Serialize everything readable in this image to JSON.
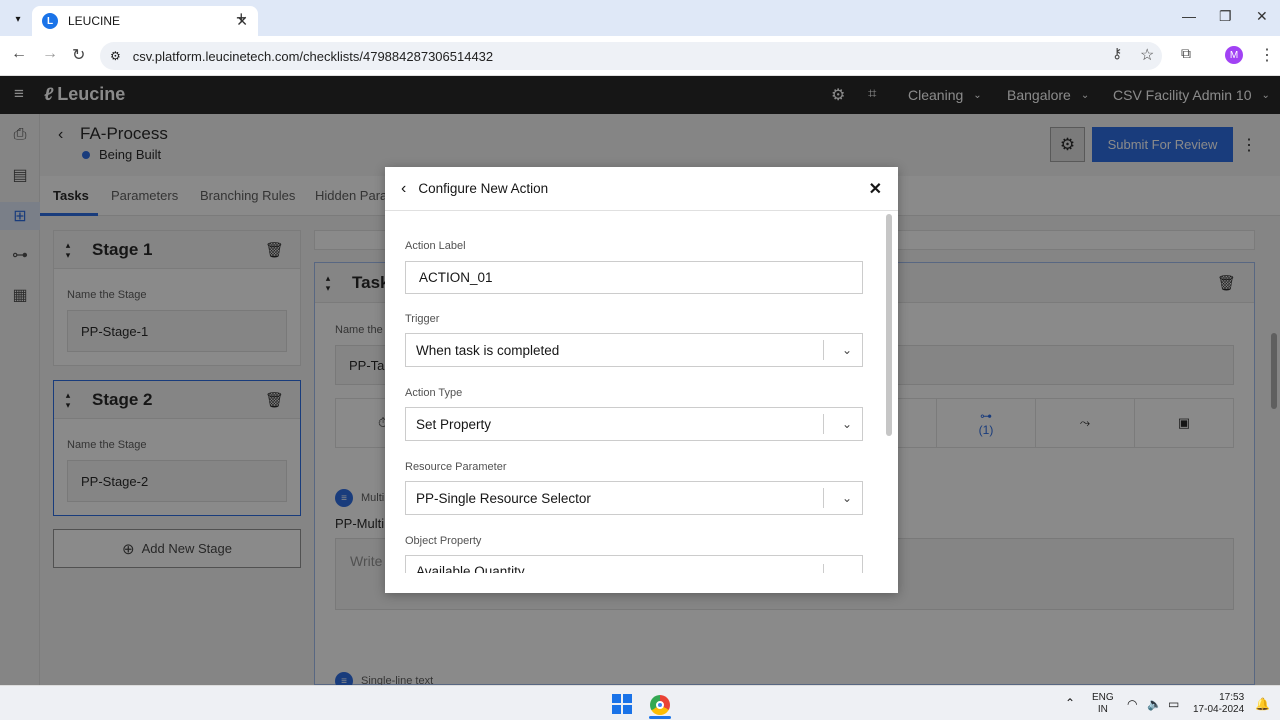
{
  "browser": {
    "tab_title": "LEUCINE",
    "tab_close": "✕",
    "new_tab": "+",
    "url": "csv.platform.leucinetech.com/checklists/479884287306514432",
    "profile_initial": "M"
  },
  "app": {
    "brand": "Leucine",
    "header": {
      "facility_type": "Cleaning",
      "location": "Bangalore",
      "user": "CSV Facility Admin 10"
    }
  },
  "process": {
    "title": "FA-Process",
    "status": "Being Built",
    "submit_label": "Submit For Review"
  },
  "page_tabs": [
    {
      "label": "Tasks"
    },
    {
      "label": "Parameters"
    },
    {
      "label": "Branching Rules"
    },
    {
      "label": "Hidden Param"
    }
  ],
  "stages": [
    {
      "title": "Stage 1",
      "field_label": "Name the Stage",
      "value": "PP-Stage-1"
    },
    {
      "title": "Stage 2",
      "field_label": "Name the Stage",
      "value": "PP-Stage-2"
    }
  ],
  "add_stage_label": "Add New Stage",
  "task_panel": {
    "title": "Task",
    "name_label": "Name the t",
    "name_value": "PP-Ta",
    "branch_count": "(1)",
    "param1_type": "Multi",
    "param1_name": "PP-Multi",
    "param1_placeholder": "Write",
    "param2_type": "Single-line text"
  },
  "modal": {
    "title": "Configure New Action",
    "fields": {
      "action_label": {
        "label": "Action Label",
        "value": "ACTION_01"
      },
      "trigger": {
        "label": "Trigger",
        "value": "When task is completed"
      },
      "action_type": {
        "label": "Action Type",
        "value": "Set Property"
      },
      "resource_parameter": {
        "label": "Resource Parameter",
        "value": "PP-Single Resource Selector"
      },
      "object_property": {
        "label": "Object Property",
        "value": "Available Quantity"
      }
    }
  },
  "taskbar": {
    "lang_line1": "ENG",
    "lang_line2": "IN",
    "time": "17:53",
    "date": "17-04-2024"
  }
}
